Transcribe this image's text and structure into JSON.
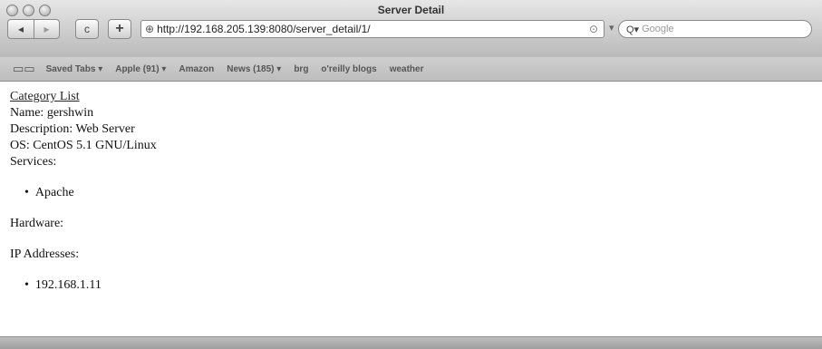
{
  "window": {
    "title": "Server Detail"
  },
  "toolbar": {
    "back_icon": "◂",
    "forward_icon": "▸",
    "reload_icon": "c",
    "add_icon": "+",
    "url": "http://192.168.205.139:8080/server_detail/1/",
    "search_placeholder": "Google"
  },
  "bookmarks": {
    "items": [
      "Saved Tabs ▾",
      "Apple (91) ▾",
      "Amazon",
      "News (185) ▾",
      "brg",
      "o'reilly blogs",
      "weather"
    ]
  },
  "page": {
    "link": "Category List",
    "name": "Name: gershwin",
    "description": "Description: Web Server",
    "os": "OS: CentOS 5.1 GNU/Linux",
    "services_label": "Services:",
    "services": [
      "Apache"
    ],
    "hardware_label": "Hardware:",
    "ip_label": "IP Addresses:",
    "ips": [
      "192.168.1.11"
    ]
  }
}
